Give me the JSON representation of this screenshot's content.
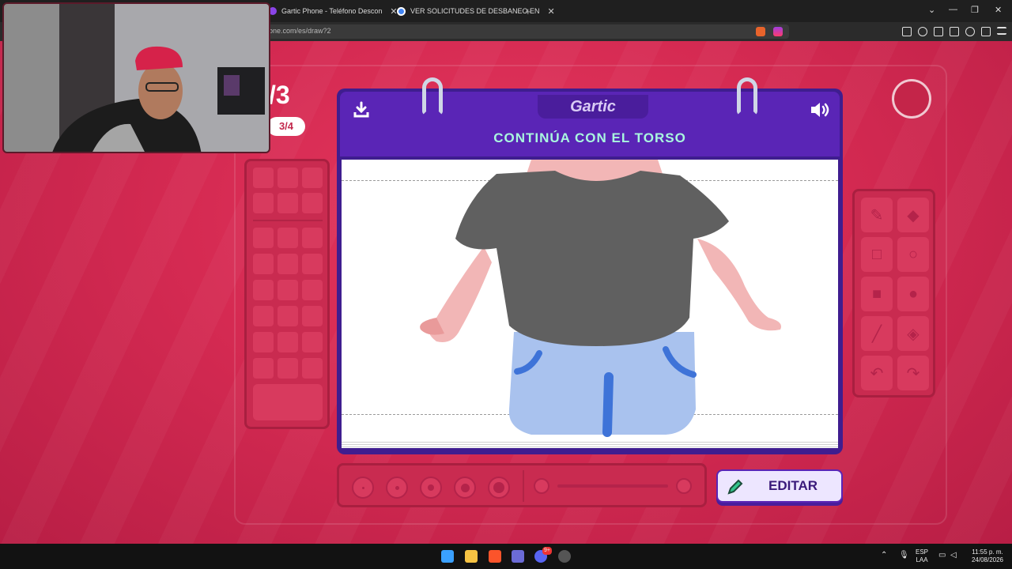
{
  "browser": {
    "tabs": [
      {
        "title": "Gartic Phone - Teléfono Descon"
      },
      {
        "title": "VER SOLICITUDES DE DESBANEO EN"
      }
    ],
    "new_tab": "+",
    "close_glyph": "✕",
    "url": "one.com/es/draw?2",
    "window_controls": [
      "⌄",
      "—",
      "❐",
      "✕"
    ]
  },
  "game": {
    "round": "/3",
    "round_pill": "3/4",
    "logo": "Gartic",
    "instruction": "CONTINÚA CON EL TORSO",
    "edit_button": "EDITAR",
    "tools": [
      "pencil-icon",
      "eraser-icon",
      "square-outline-icon",
      "circle-outline-icon",
      "square-filled-icon",
      "circle-filled-icon",
      "line-icon",
      "fill-bucket-icon",
      "undo-icon",
      "redo-icon"
    ],
    "brush_sizes": [
      1,
      2,
      3,
      4,
      5
    ]
  },
  "taskbar": {
    "lang_top": "ESP",
    "lang_bottom": "LAA",
    "time": "11:55 p. m.",
    "date": "24/08/2026",
    "discord_badge": "9+"
  },
  "colors": {
    "accent": "#5a25b6",
    "instruction": "#a9f7df",
    "background": "#d52a52"
  }
}
